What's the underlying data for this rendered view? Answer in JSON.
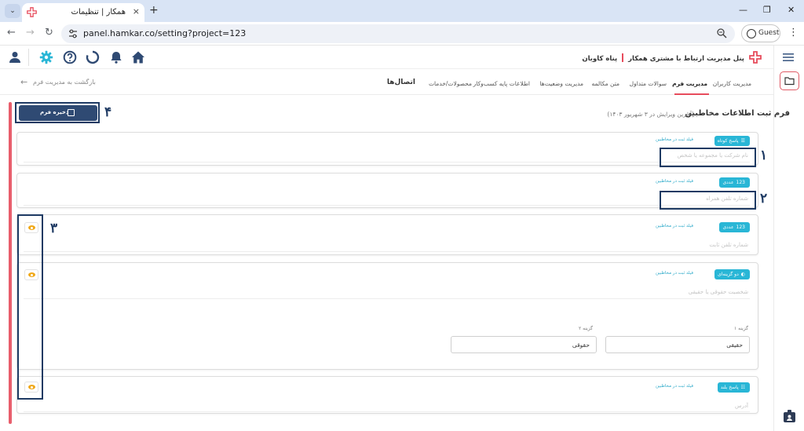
{
  "browser": {
    "tab_title": "همکار | تنظیمات",
    "tab_close": "×",
    "new_tab": "+",
    "tab_menu": "⌄",
    "url": "panel.hamkar.co/setting?project=123",
    "profile_label": "Guest",
    "back": "←",
    "forward": "→",
    "reload": "↻",
    "menu": "⋮",
    "minimize": "—",
    "maximize": "❐",
    "close": "✕"
  },
  "brand": {
    "title": "پنل مدیریت ارتباط با مشتری همکار",
    "company": "پناه کاویان",
    "accent": "#e74c5c",
    "primary": "#2f4a73",
    "info": "#29b6d6"
  },
  "header_icons": [
    "user-icon",
    "settings-icon",
    "help-icon",
    "loading-icon",
    "bell-icon",
    "home-icon"
  ],
  "settings_tabs": {
    "back_label": "بازگشت به مدیریت فرم",
    "items": [
      {
        "label": "مدیریت کاربران"
      },
      {
        "label": "مدیریت فرم"
      },
      {
        "label": "سوالات متداول"
      },
      {
        "label": "متن مکالمه"
      },
      {
        "label": "مدیریت وضعیت‌ها"
      },
      {
        "label": "اطلاعات پایه کسب‌وکار"
      },
      {
        "label": "محصولات/خدمات"
      },
      {
        "label": "اتصال‌ها"
      }
    ],
    "active_index": 1
  },
  "form": {
    "title": "فرم ثبت اطلاعات مخاطبین",
    "last_edit": "(آخرین ویرایش در ۳ شهریور ۱۴۰۳)",
    "save_label": "ذخیره فرم"
  },
  "fields": [
    {
      "type_label": "پاسخ کوتاه",
      "type_icon": "short-answer-icon",
      "subtitle": "فیلد ثبت در مخاطبین",
      "placeholder": "نام شرکت یا مجموعه یا شخص",
      "visibility_toggle": false
    },
    {
      "type_label": "عددی",
      "type_icon": "number-icon",
      "subtitle": "فیلد ثبت در مخاطبین",
      "placeholder": "شماره تلفن همراه",
      "visibility_toggle": false
    },
    {
      "type_label": "عددی",
      "type_icon": "number-icon",
      "subtitle": "فیلد ثبت در مخاطبین",
      "placeholder": "شماره تلفن ثابت",
      "visibility_toggle": true
    },
    {
      "type_label": "دو گزینه‌ای",
      "type_icon": "toggle-icon",
      "subtitle": "فیلد ثبت در مخاطبین",
      "placeholder": "شخصیت حقوقی یا حقیقی",
      "visibility_toggle": true,
      "options": [
        {
          "label": "گزینه ۱",
          "value": "حقیقی"
        },
        {
          "label": "گزینه ۲",
          "value": "حقوقی"
        }
      ]
    },
    {
      "type_label": "پاسخ بلند",
      "type_icon": "long-answer-icon",
      "subtitle": "فیلد ثبت در مخاطبین",
      "placeholder": "آدرس",
      "visibility_toggle": true
    }
  ],
  "annotations": [
    "۱",
    "۲",
    "۳",
    "۴"
  ]
}
